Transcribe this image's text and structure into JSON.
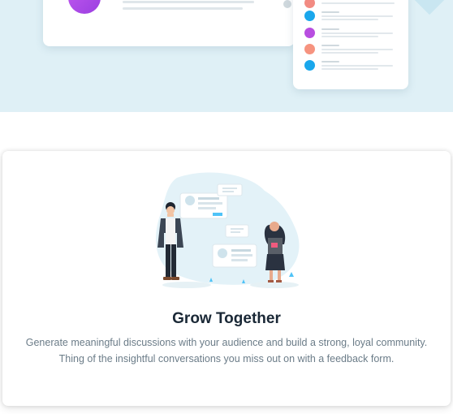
{
  "feature": {
    "title": "Grow Together",
    "description": "Generate meaningful discussions with your audience and build a strong, loyal community. Thing of the insightful conversations you miss out on with a feedback form."
  },
  "colors": {
    "hero_background": "#dff0f6",
    "accent_blue": "#1aa7ec",
    "accent_purple": "#b84ee0",
    "accent_coral": "#f28b82",
    "title_color": "#1a2836",
    "text_color": "#6b7c88"
  },
  "icons": [
    "avatar-circle",
    "status-dot",
    "plant-sprout-icon"
  ]
}
